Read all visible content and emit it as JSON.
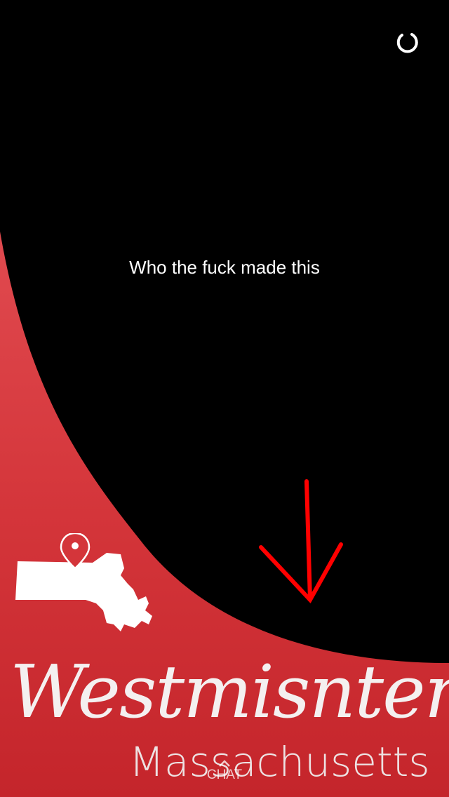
{
  "snap": {
    "caption": "Who the fuck made this",
    "geofilter_title": "Westmisnter",
    "geofilter_subtitle": "Massachusetts"
  },
  "controls": {
    "loading_icon": "spinner-icon",
    "chat_label": "CHAT",
    "chat_icon": "chevron-up-icon"
  },
  "colors": {
    "filter_red": "#d3353a",
    "arrow_red": "#ff0000"
  }
}
